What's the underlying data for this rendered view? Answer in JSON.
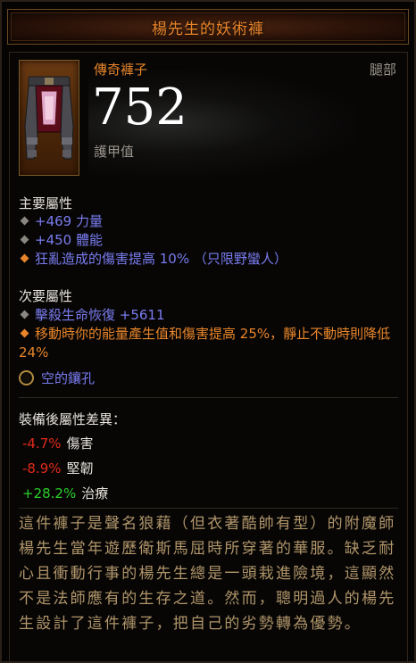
{
  "item": {
    "name": "楊先生的妖術褲",
    "type": "傳奇褲子",
    "slot": "腿部",
    "armor_value": "752",
    "armor_label": "護甲值"
  },
  "primary": {
    "heading": "主要屬性",
    "stats": [
      {
        "text": "+469 力量",
        "bullet": "grey"
      },
      {
        "text": "+450 體能",
        "bullet": "grey"
      },
      {
        "text": "狂亂造成的傷害提高 10% （只限野蠻人）",
        "bullet": "orange"
      }
    ]
  },
  "secondary": {
    "heading": "次要屬性",
    "stats": [
      {
        "text": "擊殺生命恢復 +5611",
        "bullet": "grey"
      },
      {
        "text": "移動時你的能量產生值和傷害提高 25%，靜止不動時則降低 24%",
        "bullet": "orange"
      }
    ]
  },
  "socket": {
    "label": "空的鑲孔",
    "icon": "socket-icon"
  },
  "comparison": {
    "heading": "裝備後屬性差異：",
    "rows": [
      {
        "value": "-4.7%",
        "label": "傷害",
        "direction": "negative"
      },
      {
        "value": "-8.9%",
        "label": "堅韌",
        "direction": "negative"
      },
      {
        "value": "+28.2%",
        "label": "治療",
        "direction": "positive"
      }
    ]
  },
  "flavor_text": "這件褲子是聲名狼藉（但衣著酷帥有型）的附魔師楊先生當年遊歷衛斯馬屈時所穿著的華服。缺乏耐心且衝動行事的楊先生總是一頭栽進險境，這顯然不是法師應有的生存之道。然而，聰明過人的楊先生設計了這件褲子，把自己的劣勢轉為優勢。",
  "colors": {
    "legendary_orange": "#e8852a",
    "magic_blue": "#7a7cf0",
    "negative_red": "#e02a1a",
    "positive_green": "#2ad02a",
    "flavor_gold": "#b0956a"
  }
}
